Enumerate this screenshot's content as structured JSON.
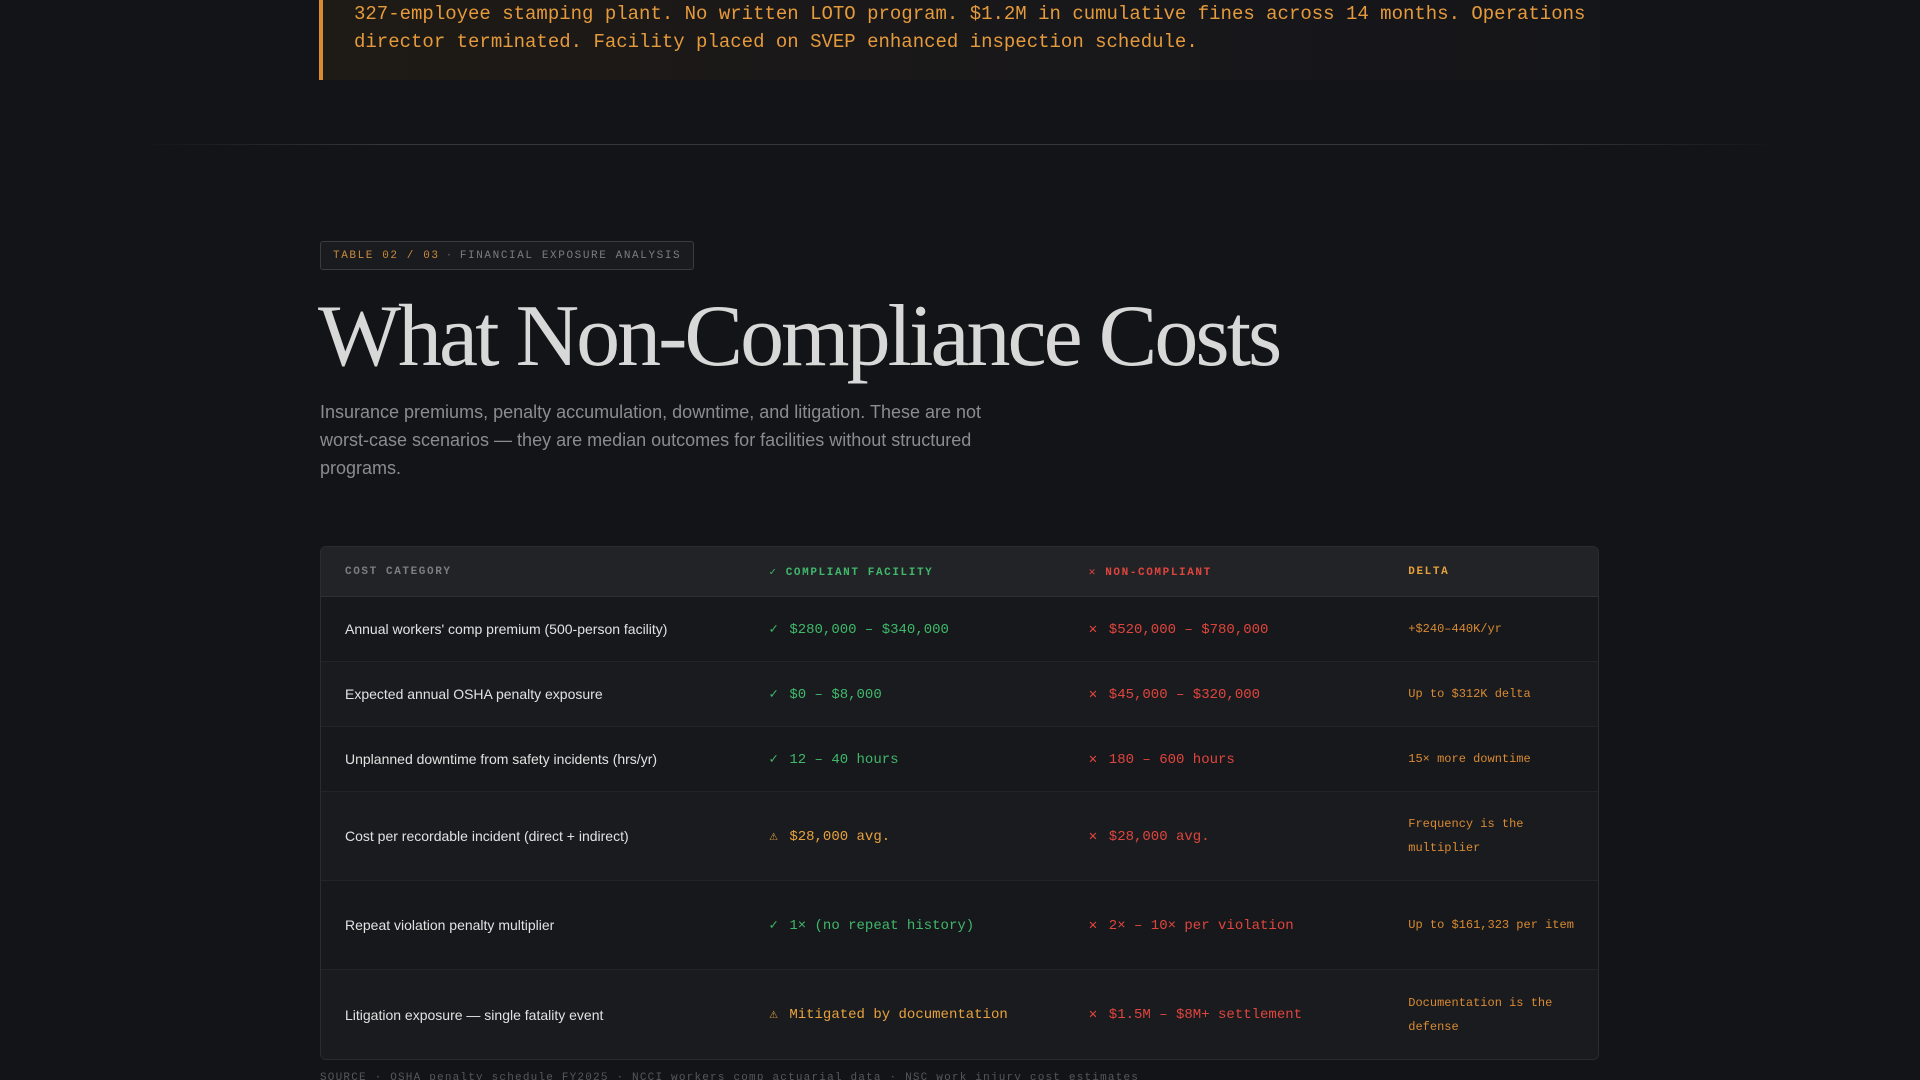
{
  "callout": {
    "text": "327-employee stamping plant. No written LOTO program. $1.2M in cumulative fines across 14 months. Operations director terminated. Facility placed on SVEP enhanced inspection schedule."
  },
  "section": {
    "tag_number": "TABLE 02 / 03",
    "tag_separator": "·",
    "tag_label": "FINANCIAL EXPOSURE ANALYSIS",
    "title": "What Non-Compliance Costs",
    "subtitle": "Insurance premiums, penalty accumulation, downtime, and litigation. These are not worst-case scenarios — they are median outcomes for facilities without structured programs."
  },
  "table": {
    "headers": {
      "category": "COST CATEGORY",
      "compliant": "✓ COMPLIANT FACILITY",
      "non_compliant": "✕ NON-COMPLIANT",
      "delta": "DELTA"
    },
    "rows": [
      {
        "category": "Annual workers' comp premium (500-person facility)",
        "compliant_mark": "✓",
        "compliant": "$280,000 – $340,000",
        "compliant_status": "green",
        "non_mark": "✕",
        "non_compliant": "$520,000 – $780,000",
        "delta": "+$240–440K/yr"
      },
      {
        "category": "Expected annual OSHA penalty exposure",
        "compliant_mark": "✓",
        "compliant": "$0 – $8,000",
        "compliant_status": "green",
        "non_mark": "✕",
        "non_compliant": "$45,000 – $320,000",
        "delta": "Up to $312K delta"
      },
      {
        "category": "Unplanned downtime from safety incidents (hrs/yr)",
        "compliant_mark": "✓",
        "compliant": "12 – 40 hours",
        "compliant_status": "green",
        "non_mark": "✕",
        "non_compliant": "180 – 600 hours",
        "delta": "15× more downtime"
      },
      {
        "category": "Cost per recordable incident (direct + indirect)",
        "compliant_mark": "⚠",
        "compliant": "$28,000 avg.",
        "compliant_status": "orange",
        "non_mark": "✕",
        "non_compliant": "$28,000 avg.",
        "delta": "Frequency is the multiplier"
      },
      {
        "category": "Repeat violation penalty multiplier",
        "compliant_mark": "✓",
        "compliant": "1× (no repeat history)",
        "compliant_status": "green",
        "non_mark": "✕",
        "non_compliant": "2× – 10× per violation",
        "delta": "Up to $161,323 per item"
      },
      {
        "category": "Litigation exposure — single fatality event",
        "compliant_mark": "⚠",
        "compliant": "Mitigated by documentation",
        "compliant_status": "orange",
        "non_mark": "✕",
        "non_compliant": "$1.5M – $8M+ settlement",
        "delta": "Documentation is the defense"
      }
    ]
  },
  "source": "SOURCE · OSHA penalty schedule FY2025 · NCCI workers comp actuarial data · NSC work injury cost estimates",
  "colors": {
    "accent_orange": "#e59a3c",
    "compliant_green": "#3fb86b",
    "non_compliant_red": "#e0453d",
    "background": "#131417"
  }
}
